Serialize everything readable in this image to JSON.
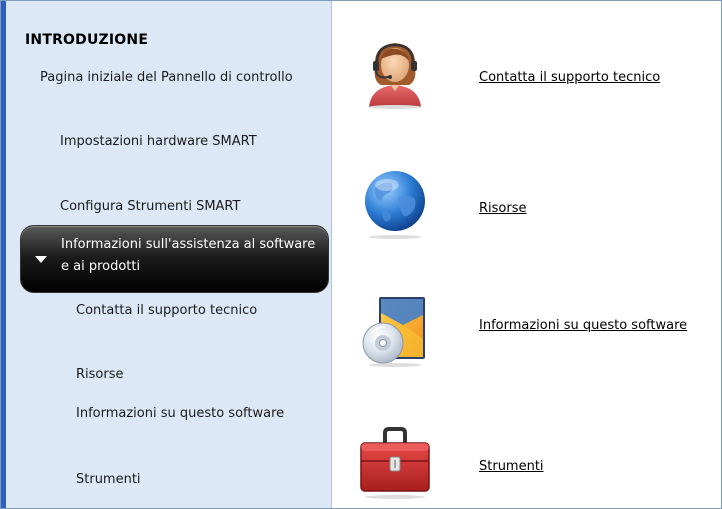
{
  "sidebar": {
    "heading": "INTRODUZIONE",
    "items": [
      {
        "label": "Pagina iniziale del Pannello di controllo"
      },
      {
        "label": "Impostazioni hardware SMART"
      },
      {
        "label": "Configura Strumenti SMART"
      },
      {
        "label": "Informazioni sull'assistenza al software e ai prodotti",
        "active": true
      }
    ],
    "subitems": [
      {
        "label": "Contatta il supporto tecnico"
      },
      {
        "label": "Risorse"
      },
      {
        "label": "Informazioni su questo software"
      },
      {
        "label": "Strumenti"
      }
    ]
  },
  "main": {
    "items": [
      {
        "label": "Contatta il supporto tecnico",
        "icon": "support-agent-icon"
      },
      {
        "label": "Risorse",
        "icon": "globe-icon"
      },
      {
        "label": "Informazioni su questo software",
        "icon": "software-box-icon"
      },
      {
        "label": "Strumenti",
        "icon": "toolbox-icon"
      }
    ]
  },
  "colors": {
    "sidebar_bg": "#dde8f6",
    "active_bg": "#000000",
    "accent_blue": "#2f5fbd"
  }
}
